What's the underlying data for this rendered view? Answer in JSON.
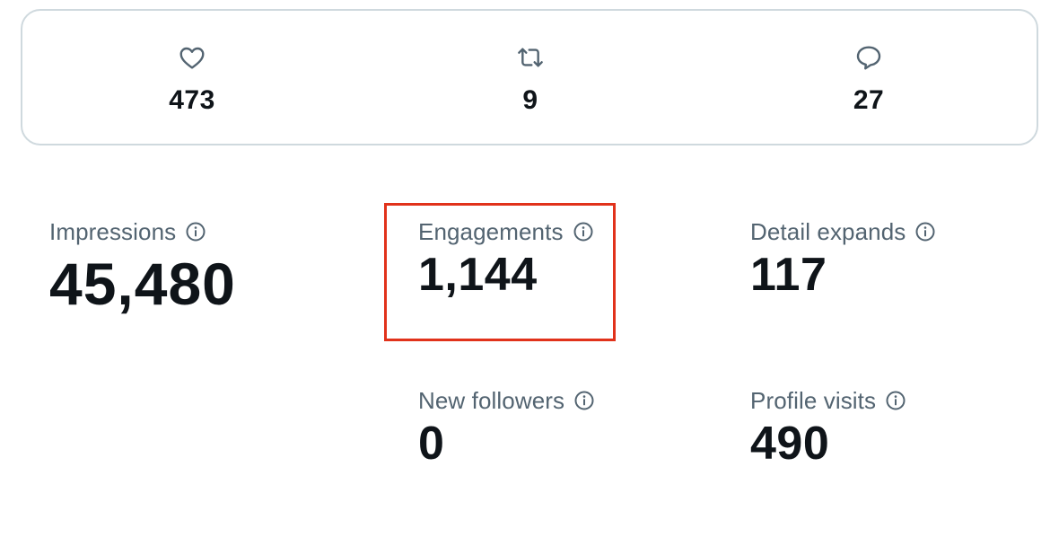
{
  "engagement_summary": {
    "likes": {
      "icon": "heart-icon",
      "count": "473"
    },
    "reposts": {
      "icon": "repost-icon",
      "count": "9"
    },
    "replies": {
      "icon": "reply-icon",
      "count": "27"
    }
  },
  "metrics": {
    "impressions": {
      "label": "Impressions",
      "value": "45,480"
    },
    "engagements": {
      "label": "Engagements",
      "value": "1,144"
    },
    "detail_expands": {
      "label": "Detail expands",
      "value": "117"
    },
    "new_followers": {
      "label": "New followers",
      "value": "0"
    },
    "profile_visits": {
      "label": "Profile visits",
      "value": "490"
    }
  },
  "colors": {
    "text_primary": "#0f1419",
    "text_secondary": "#536471",
    "border": "#cfd9de",
    "highlight": "#e1321b"
  }
}
